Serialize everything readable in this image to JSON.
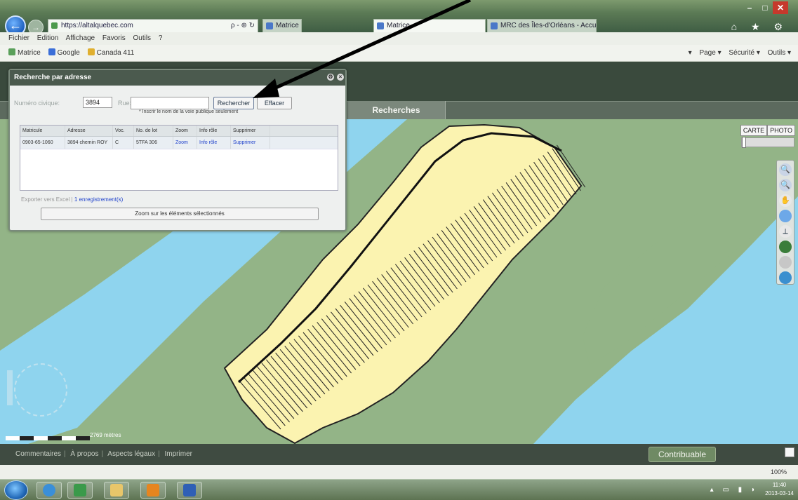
{
  "browser": {
    "address": "https://altalquebec.com",
    "address_tools": "ρ - ⊕ ↻",
    "tabs": [
      {
        "label": "Matrice"
      },
      {
        "label": "Matrice"
      },
      {
        "label": "MRC des Îles-d'Orléans - Accueil"
      }
    ],
    "window_controls": {
      "minimize": "–",
      "maximize": "□",
      "close": "✕"
    },
    "chrome_icons": "⌂ ★ ⚙"
  },
  "menubar": [
    "Fichier",
    "Edition",
    "Affichage",
    "Favoris",
    "Outils",
    "?"
  ],
  "favorites": [
    {
      "label": "Matrice",
      "color": "#5aa05a"
    },
    {
      "label": "Google",
      "color": "#3b6fd8"
    },
    {
      "label": "Canada 411",
      "color": "#e0b030"
    }
  ],
  "commandbar": [
    "▾",
    "Page ▾",
    "Sécurité ▾",
    "Outils ▾"
  ],
  "app": {
    "tab_recherches": "Recherches"
  },
  "search_panel": {
    "title": "Recherche par adresse",
    "civic_label": "Numéro civique:",
    "civic_value": "3894",
    "rue_label": "Rue:",
    "rechercher": "Rechercher",
    "effacer": "Effacer",
    "hint": "* Inscrir le nom de la voie publique seulement",
    "columns": [
      "Matricule",
      "Adresse",
      "Voc.",
      "No. de lot",
      "Zoom",
      "Info rôle",
      "Supprimer"
    ],
    "rows": [
      {
        "matricule": "0903-65-1060",
        "adresse": "3894 chemin ROY",
        "voc": "C",
        "lot": "5TFA 306",
        "zoom": "Zoom",
        "info": "Info rôle",
        "supprimer": "Supprimer"
      }
    ],
    "export": "Exporter vers Excel",
    "count": "1 enregistrement(s)",
    "zoom_selection": "Zoom sur les éléments sélectionnés"
  },
  "map": {
    "type_carte": "CARTE",
    "type_photo": "PHOTO",
    "scale_label": "2769 mètres",
    "colors": {
      "water": "#8fd4ee",
      "land": "#93b487",
      "parcel": "#fbf3b0"
    }
  },
  "footer": {
    "links": [
      "Commentaires",
      "À propos",
      "Aspects légaux",
      "Imprimer"
    ],
    "contribuable": "Contribuable"
  },
  "status": {
    "zoom": "100%"
  },
  "clock": {
    "time": "11:40",
    "date": "2013-03-14"
  }
}
